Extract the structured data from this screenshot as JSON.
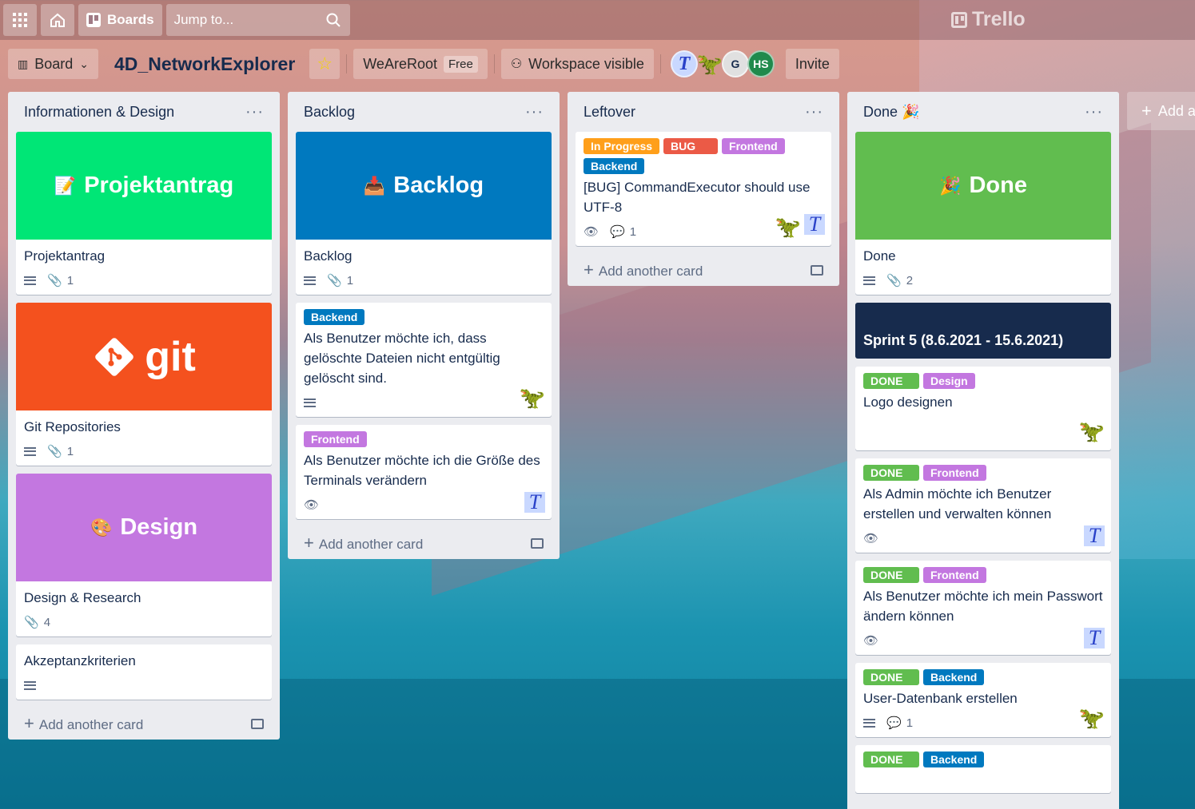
{
  "nav": {
    "boards_label": "Boards",
    "jump_placeholder": "Jump to...",
    "logo_text": "Trello"
  },
  "board": {
    "view_label": "Board",
    "title": "4D_NetworkExplorer",
    "workspace": "WeAreRoot",
    "plan": "Free",
    "visibility": "Workspace visible",
    "invite_label": "Invite",
    "members": [
      "T",
      "🦖",
      "G",
      "HS"
    ]
  },
  "colors": {
    "green": "#61bd4f",
    "bright_green": "#00e676",
    "blue": "#0079bf",
    "purple": "#c377e0",
    "red_orange": "#f4511e",
    "orange": "#ff9f1a",
    "red": "#eb5a46",
    "navy": "#172b4d"
  },
  "lists": [
    {
      "title": "Informationen & Design",
      "add_label": "Add another card",
      "cards": [
        {
          "cover_text": "Projektantrag",
          "cover_emoji": "📝",
          "title": "Projektantrag",
          "attachments": "1"
        },
        {
          "cover_text": "git",
          "title": "Git Repositories",
          "attachments": "1"
        },
        {
          "cover_text": "Design",
          "cover_emoji": "🎨",
          "title": "Design & Research",
          "attachments": "4"
        },
        {
          "title": "Akzeptanzkriterien"
        }
      ]
    },
    {
      "title": "Backlog",
      "add_label": "Add another card",
      "cards": [
        {
          "cover_text": "Backlog",
          "cover_emoji": "📥",
          "title": "Backlog",
          "attachments": "1"
        },
        {
          "labels": [
            "Backend"
          ],
          "title": "Als Benutzer möchte ich, dass gelöschte Dateien nicht entgültig gelöscht sind."
        },
        {
          "labels": [
            "Frontend"
          ],
          "title": "Als Benutzer möchte ich die Größe des Terminals verändern"
        }
      ]
    },
    {
      "title": "Leftover",
      "add_label": "Add another card",
      "cards": [
        {
          "labels": [
            "In Progress",
            "BUG",
            "Frontend",
            "Backend"
          ],
          "title": "[BUG] CommandExecutor should use UTF-8",
          "comments": "1"
        }
      ]
    },
    {
      "title": "Done",
      "title_emoji": "🎉",
      "cards": [
        {
          "cover_text": "Done",
          "cover_emoji": "🎉",
          "title": "Done",
          "attachments": "2"
        },
        {
          "sprint": "Sprint 5 (8.6.2021 - 15.6.2021)"
        },
        {
          "labels": [
            "DONE",
            "Design"
          ],
          "title": "Logo designen"
        },
        {
          "labels": [
            "DONE",
            "Frontend"
          ],
          "title": "Als Admin möchte ich Benutzer erstellen und verwalten können"
        },
        {
          "labels": [
            "DONE",
            "Frontend"
          ],
          "title": "Als Benutzer möchte ich mein Passwort ändern können"
        },
        {
          "labels": [
            "DONE",
            "Backend"
          ],
          "title": "User-Datenbank erstellen",
          "comments": "1"
        },
        {
          "labels": [
            "DONE",
            "Backend"
          ]
        }
      ]
    }
  ],
  "add_list_label": "Add a"
}
